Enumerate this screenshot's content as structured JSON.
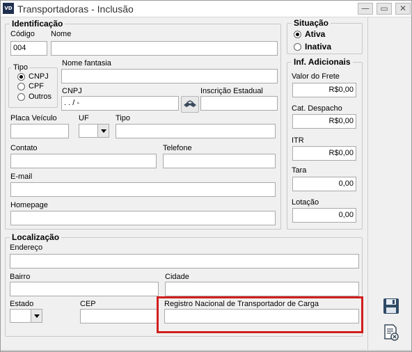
{
  "window": {
    "icon_text": "VD",
    "title": "Transportadoras - Inclusão",
    "minimize": "—",
    "maximize": "▭",
    "close": "✕"
  },
  "identificacao": {
    "title": "Identificação",
    "codigo_label": "Código",
    "codigo_value": "004",
    "nome_label": "Nome",
    "nome_value": "",
    "tipo": {
      "title": "Tipo",
      "options": [
        "CNPJ",
        "CPF",
        "Outros"
      ],
      "selected": "CNPJ"
    },
    "nome_fantasia_label": "Nome fantasia",
    "nome_fantasia_value": "",
    "cnpj_label": "CNPJ",
    "cnpj_value": " .  .  /  -",
    "inscricao_label": "Inscrição Estadual",
    "inscricao_value": "",
    "placa_label": "Placa Veículo",
    "placa_value": "",
    "uf_label": "UF",
    "uf_value": "",
    "tipo_veiculo_label": "Tipo",
    "tipo_veiculo_value": "",
    "contato_label": "Contato",
    "contato_value": "",
    "telefone_label": "Telefone",
    "telefone_value": "",
    "email_label": "E-mail",
    "email_value": "",
    "homepage_label": "Homepage",
    "homepage_value": ""
  },
  "situacao": {
    "title": "Situação",
    "options": [
      "Ativa",
      "Inativa"
    ],
    "selected": "Ativa"
  },
  "inf_adicionais": {
    "title": "Inf. Adicionais",
    "fields": [
      {
        "label": "Valor do Frete",
        "value": "R$0,00"
      },
      {
        "label": "Cat. Despacho",
        "value": "R$0,00"
      },
      {
        "label": "ITR",
        "value": "R$0,00"
      },
      {
        "label": "Tara",
        "value": "0,00"
      },
      {
        "label": "Lotação",
        "value": "0,00"
      }
    ]
  },
  "localizacao": {
    "title": "Localização",
    "endereco_label": "Endereço",
    "endereco_value": "",
    "bairro_label": "Bairro",
    "bairro_value": "",
    "cidade_label": "Cidade",
    "cidade_value": "",
    "estado_label": "Estado",
    "estado_value": "",
    "cep_label": "CEP",
    "cep_value": "",
    "rntc_label": "Registro Nacional de Transportador de Carga",
    "rntc_value": ""
  },
  "colors": {
    "highlight": "#d21e1e",
    "background": "#f0f0f0"
  },
  "toolbar": {
    "save_icon": "floppy-disk-icon",
    "cancel_icon": "document-cancel-icon"
  }
}
